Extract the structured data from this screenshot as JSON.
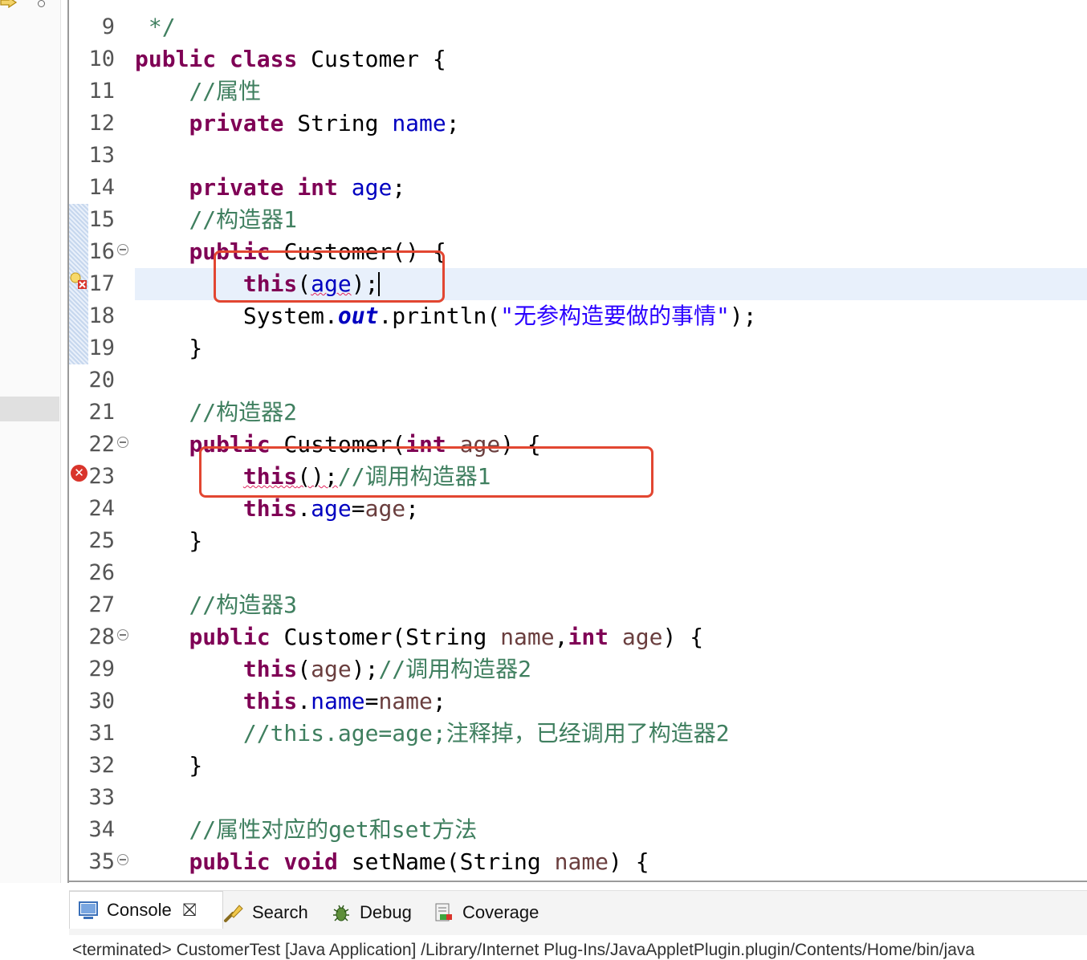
{
  "editor": {
    "lines": [
      {
        "n": "9",
        "segs": [
          {
            "t": " */",
            "c": "cm"
          }
        ]
      },
      {
        "n": "10",
        "segs": [
          {
            "t": "public",
            "c": "kw"
          },
          {
            "t": " "
          },
          {
            "t": "class",
            "c": "kw"
          },
          {
            "t": " Customer {"
          }
        ]
      },
      {
        "n": "11",
        "segs": [
          {
            "t": "    "
          },
          {
            "t": "//属性",
            "c": "cm"
          }
        ]
      },
      {
        "n": "12",
        "segs": [
          {
            "t": "    "
          },
          {
            "t": "private",
            "c": "kw"
          },
          {
            "t": " String "
          },
          {
            "t": "name",
            "c": "fld"
          },
          {
            "t": ";"
          }
        ]
      },
      {
        "n": "13",
        "segs": []
      },
      {
        "n": "14",
        "segs": [
          {
            "t": "    "
          },
          {
            "t": "private",
            "c": "kw"
          },
          {
            "t": " "
          },
          {
            "t": "int",
            "c": "kw"
          },
          {
            "t": " "
          },
          {
            "t": "age",
            "c": "fld"
          },
          {
            "t": ";"
          }
        ]
      },
      {
        "n": "15",
        "segs": [
          {
            "t": "    "
          },
          {
            "t": "//构造器1",
            "c": "cm"
          }
        ]
      },
      {
        "n": "16",
        "fold": true,
        "segs": [
          {
            "t": "    "
          },
          {
            "t": "public",
            "c": "kw"
          },
          {
            "t": " Customer() {"
          }
        ]
      },
      {
        "n": "17",
        "segs": [
          {
            "t": "        "
          },
          {
            "t": "this",
            "c": "kw"
          },
          {
            "t": "("
          },
          {
            "t": "age",
            "c": "fld err"
          },
          {
            "t": ");"
          }
        ],
        "caret": true
      },
      {
        "n": "18",
        "segs": [
          {
            "t": "        System."
          },
          {
            "t": "out",
            "c": "sfld"
          },
          {
            "t": ".println("
          },
          {
            "t": "\"无参构造要做的事情\"",
            "c": "str"
          },
          {
            "t": ");"
          }
        ]
      },
      {
        "n": "19",
        "segs": [
          {
            "t": "    }"
          }
        ]
      },
      {
        "n": "20",
        "segs": []
      },
      {
        "n": "21",
        "segs": [
          {
            "t": "    "
          },
          {
            "t": "//构造器2",
            "c": "cm"
          }
        ]
      },
      {
        "n": "22",
        "fold": true,
        "segs": [
          {
            "t": "    "
          },
          {
            "t": "public",
            "c": "kw"
          },
          {
            "t": " Customer("
          },
          {
            "t": "int",
            "c": "kw"
          },
          {
            "t": " "
          },
          {
            "t": "age",
            "c": "var"
          },
          {
            "t": ") {"
          }
        ]
      },
      {
        "n": "23",
        "segs": [
          {
            "t": "        "
          },
          {
            "t": "this",
            "c": "kw err"
          },
          {
            "t": "();",
            "c": "err"
          },
          {
            "t": "//调用构造器1",
            "c": "cm"
          }
        ]
      },
      {
        "n": "24",
        "segs": [
          {
            "t": "        "
          },
          {
            "t": "this",
            "c": "kw"
          },
          {
            "t": "."
          },
          {
            "t": "age",
            "c": "fld"
          },
          {
            "t": "="
          },
          {
            "t": "age",
            "c": "var"
          },
          {
            "t": ";"
          }
        ]
      },
      {
        "n": "25",
        "segs": [
          {
            "t": "    }"
          }
        ]
      },
      {
        "n": "26",
        "segs": []
      },
      {
        "n": "27",
        "segs": [
          {
            "t": "    "
          },
          {
            "t": "//构造器3",
            "c": "cm"
          }
        ]
      },
      {
        "n": "28",
        "fold": true,
        "segs": [
          {
            "t": "    "
          },
          {
            "t": "public",
            "c": "kw"
          },
          {
            "t": " Customer(String "
          },
          {
            "t": "name",
            "c": "var"
          },
          {
            "t": ","
          },
          {
            "t": "int",
            "c": "kw"
          },
          {
            "t": " "
          },
          {
            "t": "age",
            "c": "var"
          },
          {
            "t": ") {"
          }
        ]
      },
      {
        "n": "29",
        "segs": [
          {
            "t": "        "
          },
          {
            "t": "this",
            "c": "kw"
          },
          {
            "t": "("
          },
          {
            "t": "age",
            "c": "var"
          },
          {
            "t": ");"
          },
          {
            "t": "//调用构造器2",
            "c": "cm"
          }
        ]
      },
      {
        "n": "30",
        "segs": [
          {
            "t": "        "
          },
          {
            "t": "this",
            "c": "kw"
          },
          {
            "t": "."
          },
          {
            "t": "name",
            "c": "fld"
          },
          {
            "t": "="
          },
          {
            "t": "name",
            "c": "var"
          },
          {
            "t": ";"
          }
        ]
      },
      {
        "n": "31",
        "segs": [
          {
            "t": "        "
          },
          {
            "t": "//this.age=age;注释掉，已经调用了构造器2",
            "c": "cm"
          }
        ]
      },
      {
        "n": "32",
        "segs": [
          {
            "t": "    }"
          }
        ]
      },
      {
        "n": "33",
        "segs": []
      },
      {
        "n": "34",
        "segs": [
          {
            "t": "    "
          },
          {
            "t": "//属性对应的get和set方法",
            "c": "cm"
          }
        ]
      },
      {
        "n": "35",
        "fold": true,
        "segs": [
          {
            "t": "    "
          },
          {
            "t": "public",
            "c": "kw"
          },
          {
            "t": " "
          },
          {
            "t": "void",
            "c": "kw"
          },
          {
            "t": " setName(String "
          },
          {
            "t": "name",
            "c": "var"
          },
          {
            "t": ") {"
          }
        ]
      }
    ]
  },
  "console": {
    "tabs": [
      {
        "label": "Console",
        "icon": "console-icon"
      },
      {
        "label": "Search",
        "icon": "search-icon"
      },
      {
        "label": "Debug",
        "icon": "debug-icon"
      },
      {
        "label": "Coverage",
        "icon": "coverage-icon"
      }
    ],
    "status_line": "<terminated> CustomerTest [Java Application] /Library/Internet Plug-Ins/JavaAppletPlugin.plugin/Contents/Home/bin/java"
  }
}
